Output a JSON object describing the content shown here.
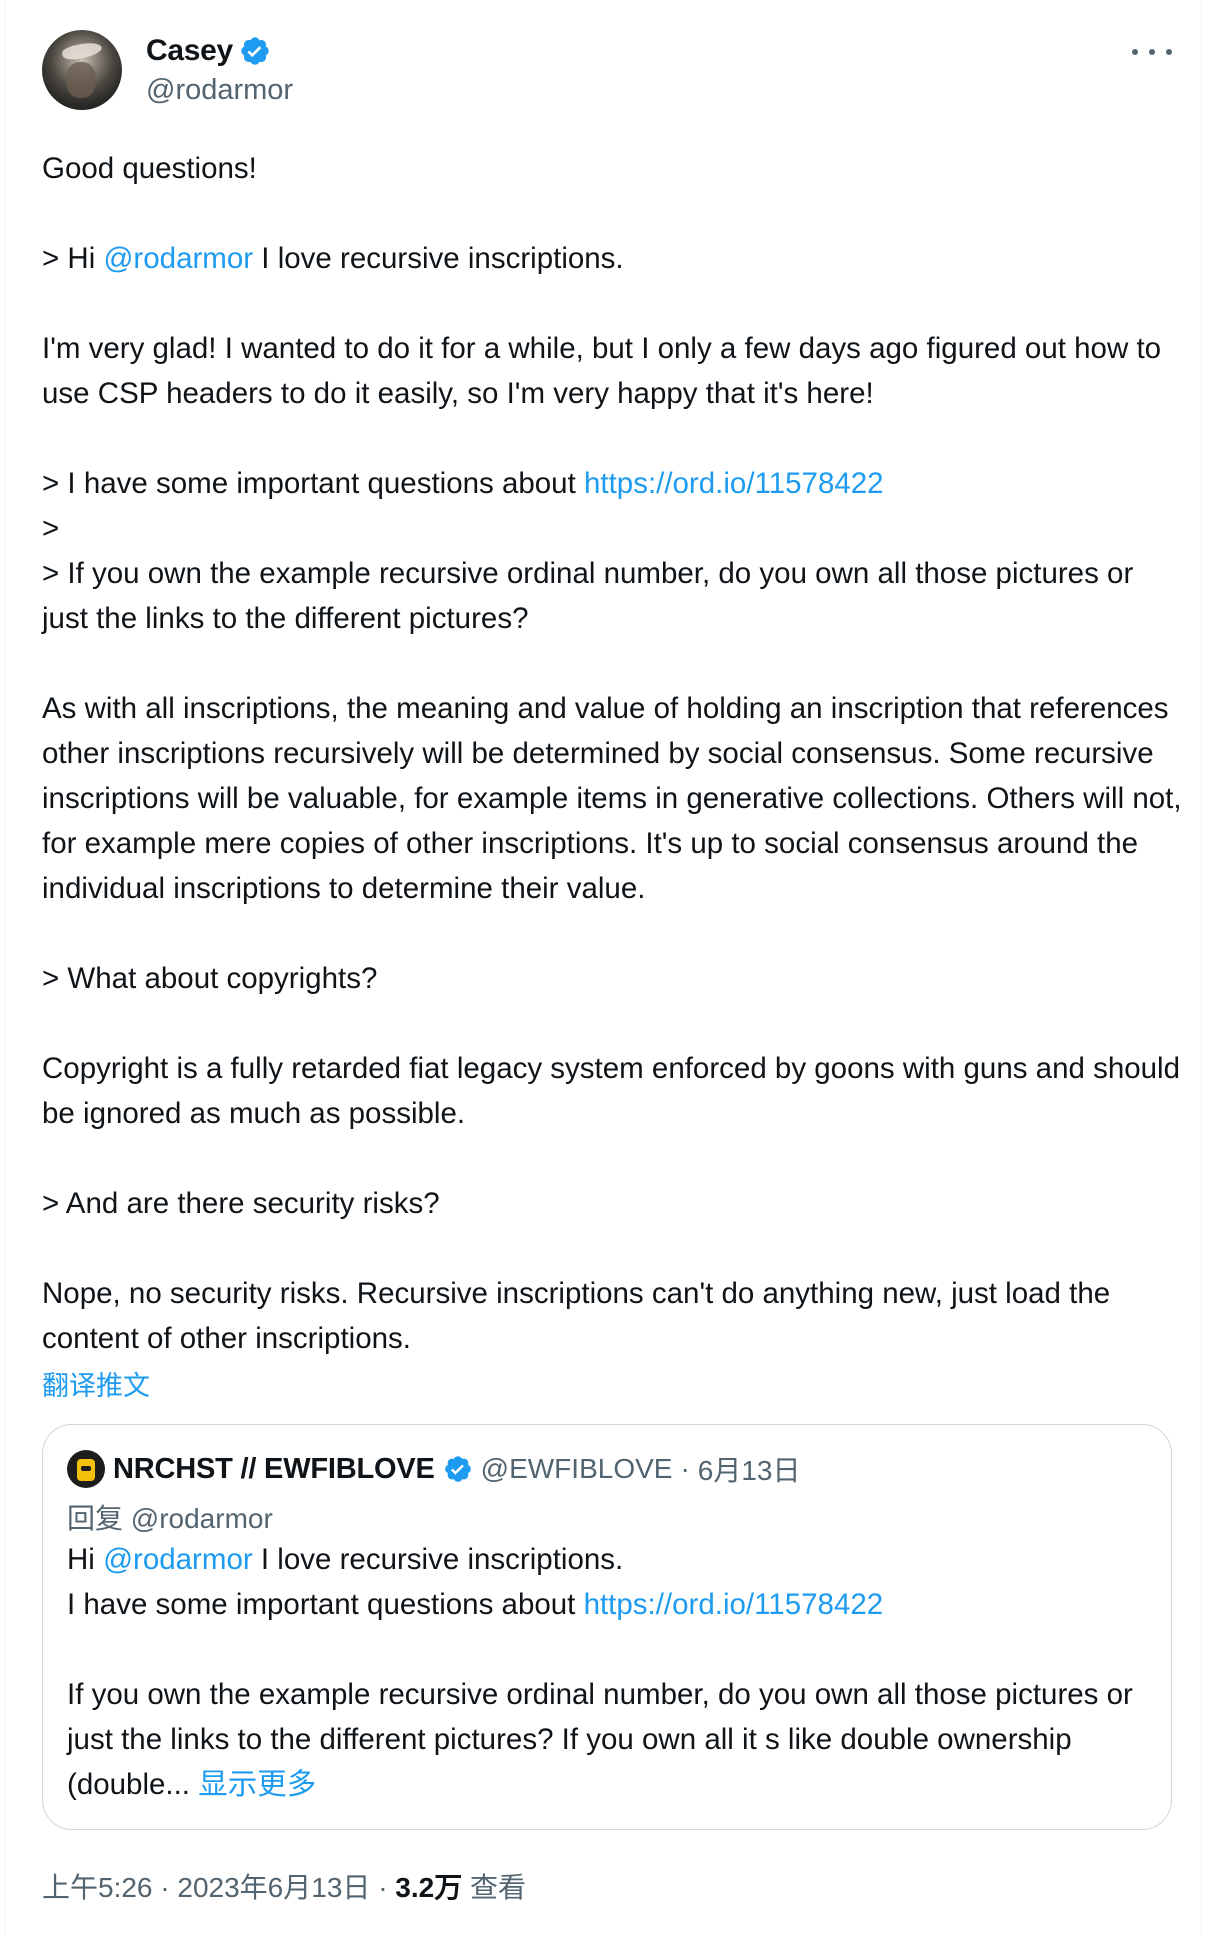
{
  "tweet": {
    "author": {
      "name": "Casey",
      "handle": "@rodarmor",
      "verified": true
    },
    "intro": "Good questions!",
    "q1_prefix": "> Hi ",
    "q1_mention": "@rodarmor",
    "q1_suffix": " I love recursive inscriptions.",
    "a1": "I'm very glad! I wanted to do it for a while, but I only a few days ago figured out how to use CSP headers to do it easily, so I'm very happy that it's here!",
    "q2_prefix": "> I have some important questions about ",
    "q2_link": "https://ord.io/11578422",
    "q2_blank": ">",
    "q2_cont": "> If you own the example recursive ordinal number, do you own all those pictures or just the links to the different pictures?",
    "a2": "As with all inscriptions, the meaning and value of holding an inscription that references other inscriptions recursively will be determined by social consensus. Some recursive inscriptions will be valuable, for example items in generative collections. Others will not, for example mere copies of other inscriptions. It's up to social consensus around the individual inscriptions to determine their value.",
    "q3": "> What about copyrights?",
    "a3": "Copyright is a fully retarded fiat legacy system enforced by goons with guns and should be ignored as much as possible.",
    "q4": "> And are there security risks?",
    "a4": "Nope, no security risks. Recursive inscriptions can't do anything new, just load the content of other inscriptions.",
    "translate_label": "翻译推文"
  },
  "quoted": {
    "name": "NRCHST // EWFIBLOVE",
    "handle": "@EWFIBLOVE",
    "separator": "·",
    "date": "6月13日",
    "reply_to": "回复 @rodarmor",
    "line1_prefix": "Hi ",
    "line1_mention": "@rodarmor",
    "line1_suffix": " I love recursive inscriptions.",
    "line2_prefix": "I have some important questions about ",
    "line2_link": "https://ord.io/11578422",
    "line3": "If you own the example recursive ordinal number, do you own all those pictures or just the links to the different pictures? If you own all it s like double ownership (double...",
    "show_more": "显示更多"
  },
  "footer": {
    "time": "上午5:26",
    "separator": "·",
    "date": "2023年6月13日",
    "views": "3.2万",
    "views_label": "查看"
  },
  "colors": {
    "accent": "#1d9bf0",
    "text": "#0f1419",
    "muted": "#536471",
    "border": "#cfd9de"
  },
  "icons": [
    "avatar",
    "verified-badge-icon",
    "more-options-icon"
  ]
}
